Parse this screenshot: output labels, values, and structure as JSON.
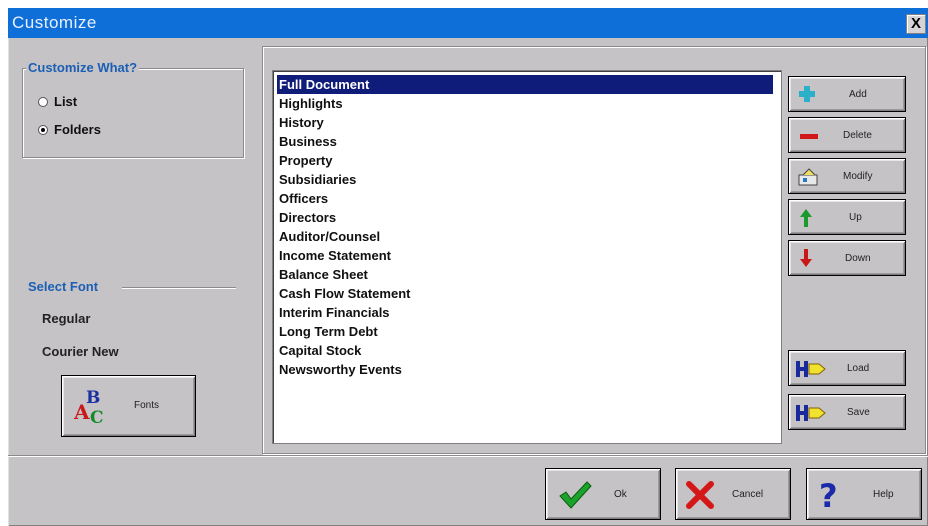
{
  "window": {
    "title": "Customize",
    "close_label": "X"
  },
  "customize_what": {
    "label": "Customize What?",
    "options": [
      {
        "label": "List",
        "selected": false
      },
      {
        "label": "Folders",
        "selected": true
      }
    ]
  },
  "select_font": {
    "label": "Select Font",
    "style": "Regular",
    "family": "Courier New",
    "fonts_button": "Fonts"
  },
  "list": {
    "items": [
      "Full Document",
      "Highlights",
      "History",
      "Business",
      "Property",
      "Subsidiaries",
      "Officers",
      "Directors",
      "Auditor/Counsel",
      "Income Statement",
      "Balance Sheet",
      "Cash Flow Statement",
      "Interim Financials",
      "Long Term Debt",
      "Capital Stock",
      "Newsworthy Events"
    ],
    "selected_index": 0
  },
  "side_buttons": {
    "add": "Add",
    "delete": "Delete",
    "modify": "Modify",
    "up": "Up",
    "down": "Down",
    "load": "Load",
    "save": "Save"
  },
  "footer_buttons": {
    "ok": "Ok",
    "cancel": "Cancel",
    "help": "Help"
  },
  "colors": {
    "title_bar": "#0f6fd8",
    "selection": "#101c7a",
    "group_label": "#1b5fb5",
    "dialog_bg": "#c6c3c6"
  }
}
